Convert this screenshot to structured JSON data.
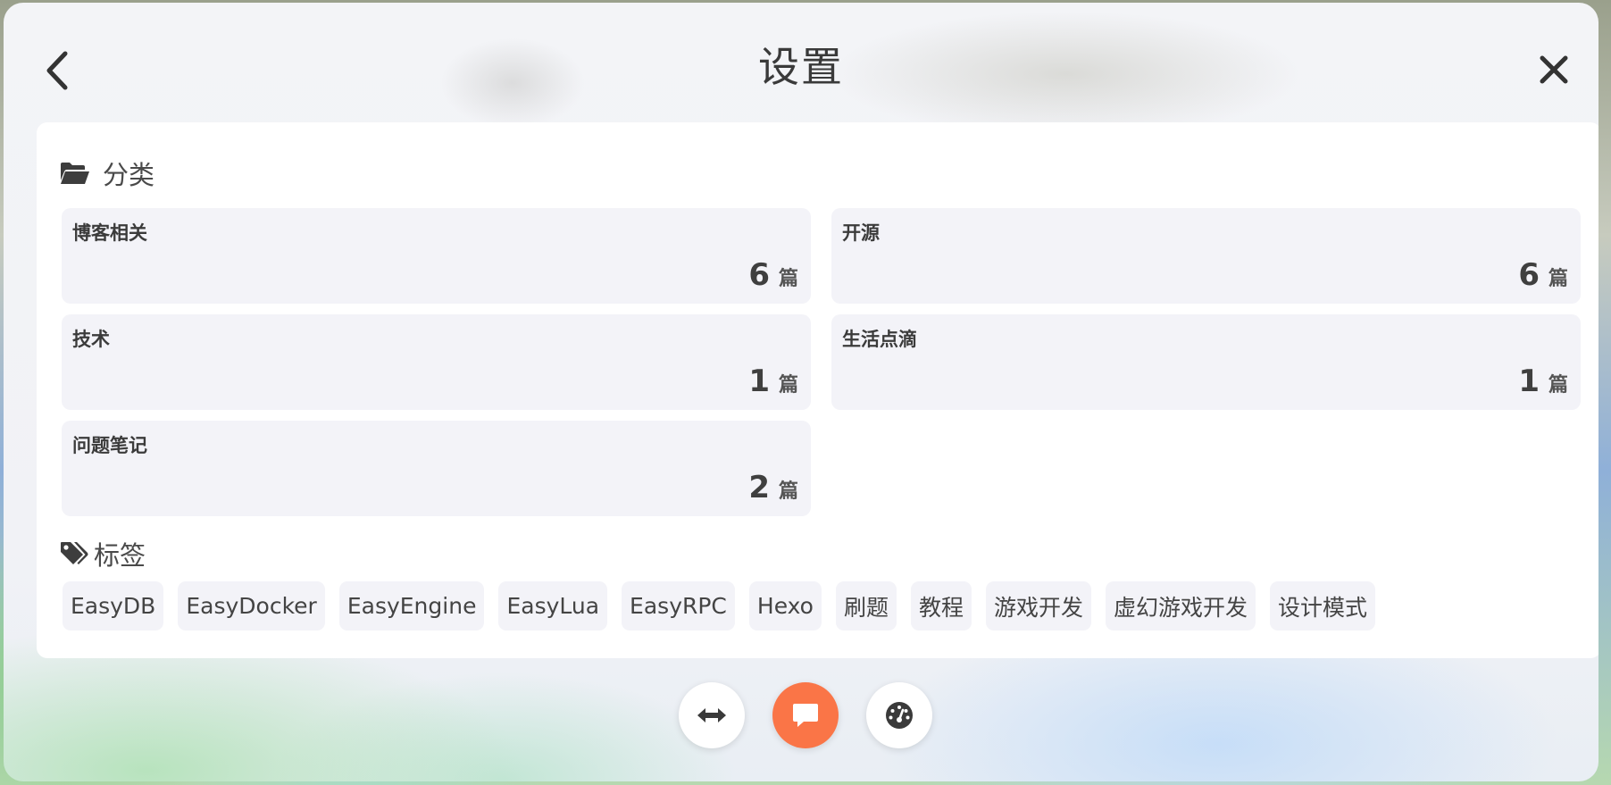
{
  "header": {
    "title": "设置",
    "back_icon": "chevron-left-icon",
    "close_icon": "close-icon"
  },
  "categories_section": {
    "heading": "分类",
    "icon": "folder-open-icon",
    "items": [
      {
        "name": "博客相关",
        "count": "6",
        "unit": "篇"
      },
      {
        "name": "开源",
        "count": "6",
        "unit": "篇"
      },
      {
        "name": "技术",
        "count": "1",
        "unit": "篇"
      },
      {
        "name": "生活点滴",
        "count": "1",
        "unit": "篇"
      },
      {
        "name": "问题笔记",
        "count": "2",
        "unit": "篇"
      }
    ]
  },
  "tags_section": {
    "heading": "标签",
    "icon": "tags-icon",
    "items": [
      "EasyDB",
      "EasyDocker",
      "EasyEngine",
      "EasyLua",
      "EasyRPC",
      "Hexo",
      "刷题",
      "教程",
      "游戏开发",
      "虚幻游戏开发",
      "设计模式"
    ]
  },
  "bottom_bar": {
    "buttons": [
      {
        "icon": "arrows-horizontal-icon",
        "active": false
      },
      {
        "icon": "comment-icon",
        "active": true,
        "color": "#fa7547"
      },
      {
        "icon": "gauge-icon",
        "active": false
      }
    ]
  },
  "colors": {
    "accent": "#fa7547",
    "card_background": "#ffffff",
    "item_background": "#f3f3f8"
  }
}
